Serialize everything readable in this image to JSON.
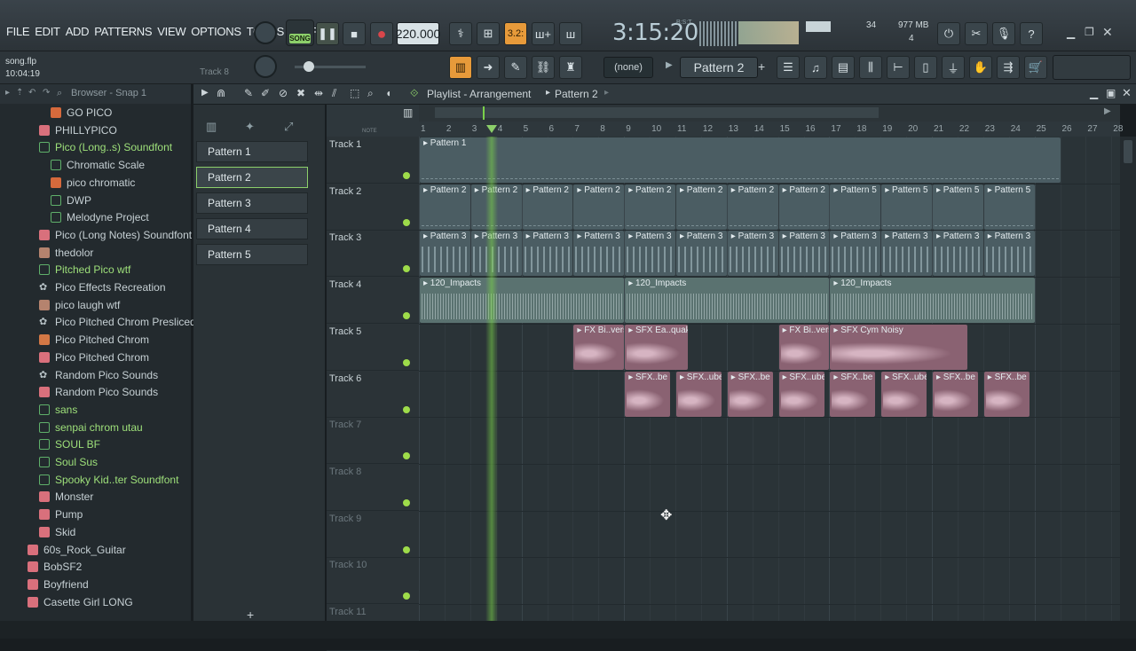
{
  "menu": [
    "FILE",
    "EDIT",
    "ADD",
    "PATTERNS",
    "VIEW",
    "OPTIONS",
    "TOOLS",
    "HELP"
  ],
  "file": {
    "name": "song.flp",
    "time": "10:04:19",
    "hint": "Track 8"
  },
  "transport": {
    "song_label": "SONG",
    "tempo": "220.000",
    "time": "3:15:20",
    "time_sig": "B:S:T",
    "step": "3.2:"
  },
  "cpu": {
    "value": "34",
    "memory": "977 MB",
    "poly": "4"
  },
  "toolbar2": {
    "preset": "(none)",
    "pattern": "Pattern 2"
  },
  "browser": {
    "title": "Browser - Snap 1",
    "items": [
      {
        "label": "GO PICO",
        "indent": 1,
        "icon": "folder"
      },
      {
        "label": "PHILLYPICO",
        "indent": 0,
        "icon": "sample"
      },
      {
        "label": "Pico (Long..s) Soundfont",
        "indent": 0,
        "icon": "folder-open"
      },
      {
        "label": "Chromatic Scale",
        "indent": 1,
        "icon": "folder-open"
      },
      {
        "label": "pico chromatic",
        "indent": 1,
        "icon": "folder"
      },
      {
        "label": "DWP",
        "indent": 1,
        "icon": "folder-open"
      },
      {
        "label": "Melodyne Project",
        "indent": 1,
        "icon": "folder-open"
      },
      {
        "label": "Pico (Long Notes) Soundfont",
        "indent": 0,
        "icon": "sample"
      },
      {
        "label": "thedolor",
        "indent": 0,
        "icon": "wave"
      },
      {
        "label": "Pitched Pico wtf",
        "indent": 0,
        "icon": "folder-open"
      },
      {
        "label": "Pico Effects Recreation",
        "indent": 0,
        "icon": "gear"
      },
      {
        "label": "pico laugh wtf",
        "indent": 0,
        "icon": "wave"
      },
      {
        "label": "Pico Pitched Chrom Presliced",
        "indent": 0,
        "icon": "gear"
      },
      {
        "label": "Pico Pitched Chrom",
        "indent": 0,
        "icon": "dw"
      },
      {
        "label": "Pico Pitched Chrom",
        "indent": 0,
        "icon": "sample"
      },
      {
        "label": "Random Pico Sounds",
        "indent": 0,
        "icon": "gear"
      },
      {
        "label": "Random Pico Sounds",
        "indent": 0,
        "icon": "sample"
      },
      {
        "label": "sans",
        "indent": 0,
        "icon": "folder-open"
      },
      {
        "label": "senpai chrom utau",
        "indent": 0,
        "icon": "folder-open"
      },
      {
        "label": "SOUL BF",
        "indent": 0,
        "icon": "folder-open"
      },
      {
        "label": "Soul Sus",
        "indent": 0,
        "icon": "folder-open"
      },
      {
        "label": "Spooky Kid..ter Soundfont",
        "indent": 0,
        "icon": "folder-open"
      },
      {
        "label": "Monster",
        "indent": 0,
        "icon": "sample"
      },
      {
        "label": "Pump",
        "indent": 0,
        "icon": "sample"
      },
      {
        "label": "Skid",
        "indent": 0,
        "icon": "sample"
      },
      {
        "label": "60s_Rock_Guitar",
        "indent": -1,
        "icon": "sample"
      },
      {
        "label": "BobSF2",
        "indent": -1,
        "icon": "sample"
      },
      {
        "label": "Boyfriend",
        "indent": -1,
        "icon": "sample"
      },
      {
        "label": "Casette Girl LONG",
        "indent": -1,
        "icon": "sample"
      }
    ]
  },
  "patterns": [
    "Pattern 1",
    "Pattern 2",
    "Pattern 3",
    "Pattern 4",
    "Pattern 5"
  ],
  "playlist": {
    "title": "Playlist - Arrangement",
    "pattern": "Pattern 2",
    "bars": [
      "1",
      "2",
      "3",
      "4",
      "5",
      "6",
      "7",
      "8",
      "9",
      "10",
      "11",
      "12",
      "13",
      "14",
      "15",
      "16",
      "17",
      "18",
      "19",
      "20",
      "21",
      "22",
      "23",
      "24",
      "25",
      "26",
      "27",
      "28"
    ],
    "tracks": [
      "Track 1",
      "Track 2",
      "Track 3",
      "Track 4",
      "Track 5",
      "Track 6",
      "Track 7",
      "Track 8",
      "Track 9",
      "Track 10",
      "Track 11"
    ],
    "clips": [
      {
        "track": 0,
        "label": "Pattern 1",
        "start": 1,
        "len": 25,
        "color": "blue"
      },
      {
        "track": 1,
        "label": "Pattern 2",
        "start": 1,
        "len": 2,
        "color": "blue"
      },
      {
        "track": 1,
        "label": "Pattern 2",
        "start": 3,
        "len": 2,
        "color": "blue"
      },
      {
        "track": 1,
        "label": "Pattern 2",
        "start": 5,
        "len": 2,
        "color": "blue"
      },
      {
        "track": 1,
        "label": "Pattern 2",
        "start": 7,
        "len": 2,
        "color": "blue"
      },
      {
        "track": 1,
        "label": "Pattern 2",
        "start": 9,
        "len": 2,
        "color": "blue"
      },
      {
        "track": 1,
        "label": "Pattern 2",
        "start": 11,
        "len": 2,
        "color": "blue"
      },
      {
        "track": 1,
        "label": "Pattern 2",
        "start": 13,
        "len": 2,
        "color": "blue"
      },
      {
        "track": 1,
        "label": "Pattern 2",
        "start": 15,
        "len": 2,
        "color": "blue"
      },
      {
        "track": 1,
        "label": "Pattern 5",
        "start": 17,
        "len": 2,
        "color": "blue"
      },
      {
        "track": 1,
        "label": "Pattern 5",
        "start": 19,
        "len": 2,
        "color": "blue"
      },
      {
        "track": 1,
        "label": "Pattern 5",
        "start": 21,
        "len": 2,
        "color": "blue"
      },
      {
        "track": 1,
        "label": "Pattern 5",
        "start": 23,
        "len": 2,
        "color": "blue"
      },
      {
        "track": 2,
        "label": "Pattern 3",
        "start": 1,
        "len": 2,
        "color": "blue"
      },
      {
        "track": 2,
        "label": "Pattern 3",
        "start": 3,
        "len": 2,
        "color": "blue"
      },
      {
        "track": 2,
        "label": "Pattern 3",
        "start": 5,
        "len": 2,
        "color": "blue"
      },
      {
        "track": 2,
        "label": "Pattern 3",
        "start": 7,
        "len": 2,
        "color": "blue"
      },
      {
        "track": 2,
        "label": "Pattern 3",
        "start": 9,
        "len": 2,
        "color": "blue"
      },
      {
        "track": 2,
        "label": "Pattern 3",
        "start": 11,
        "len": 2,
        "color": "blue"
      },
      {
        "track": 2,
        "label": "Pattern 3",
        "start": 13,
        "len": 2,
        "color": "blue"
      },
      {
        "track": 2,
        "label": "Pattern 3",
        "start": 15,
        "len": 2,
        "color": "blue"
      },
      {
        "track": 2,
        "label": "Pattern 3",
        "start": 17,
        "len": 2,
        "color": "blue"
      },
      {
        "track": 2,
        "label": "Pattern 3",
        "start": 19,
        "len": 2,
        "color": "blue"
      },
      {
        "track": 2,
        "label": "Pattern 3",
        "start": 21,
        "len": 2,
        "color": "blue"
      },
      {
        "track": 2,
        "label": "Pattern 3",
        "start": 23,
        "len": 2,
        "color": "blue"
      },
      {
        "track": 3,
        "label": "120_Impacts",
        "start": 1,
        "len": 8,
        "color": "teal"
      },
      {
        "track": 3,
        "label": "120_Impacts",
        "start": 9,
        "len": 8,
        "color": "teal"
      },
      {
        "track": 3,
        "label": "120_Impacts",
        "start": 17,
        "len": 8,
        "color": "teal"
      },
      {
        "track": 4,
        "label": "FX Bi..verse",
        "start": 7,
        "len": 2,
        "color": "pink"
      },
      {
        "track": 4,
        "label": "SFX Ea..quake",
        "start": 9,
        "len": 2.5,
        "color": "pink"
      },
      {
        "track": 4,
        "label": "FX Bi..verse",
        "start": 15,
        "len": 2,
        "color": "pink"
      },
      {
        "track": 4,
        "label": "SFX Cym Noisy",
        "start": 17,
        "len": 5.4,
        "color": "pink"
      },
      {
        "track": 5,
        "label": "SFX..be",
        "start": 9,
        "len": 1.8,
        "color": "pink"
      },
      {
        "track": 5,
        "label": "SFX..ube",
        "start": 11,
        "len": 1.8,
        "color": "pink"
      },
      {
        "track": 5,
        "label": "SFX..be",
        "start": 13,
        "len": 1.8,
        "color": "pink"
      },
      {
        "track": 5,
        "label": "SFX..ube",
        "start": 15,
        "len": 1.8,
        "color": "pink"
      },
      {
        "track": 5,
        "label": "SFX..be",
        "start": 17,
        "len": 1.8,
        "color": "pink"
      },
      {
        "track": 5,
        "label": "SFX..ube",
        "start": 19,
        "len": 1.8,
        "color": "pink"
      },
      {
        "track": 5,
        "label": "SFX..be",
        "start": 21,
        "len": 1.8,
        "color": "pink"
      },
      {
        "track": 5,
        "label": "SFX..be",
        "start": 23,
        "len": 1.8,
        "color": "pink"
      }
    ],
    "playhead_bar": 3.85
  },
  "colors": {
    "accent": "#8ccf6a",
    "clip_blue": "#4b5d63",
    "clip_teal": "#5f7a78",
    "clip_pink": "#8e6676",
    "playhead": "#7ad04a"
  }
}
